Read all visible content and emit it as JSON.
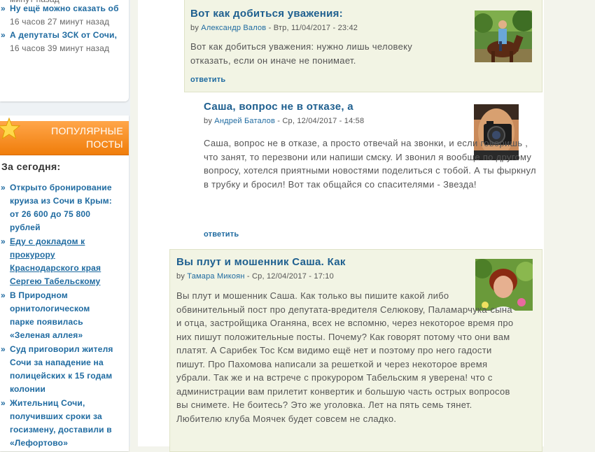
{
  "sidebar": {
    "prev_fragment": "минут назад",
    "recent": [
      {
        "title": "Ну ещё можно сказать об",
        "ago": "16 часов 27 минут назад"
      },
      {
        "title": "А депутаты ЗСК от Сочи,",
        "ago": "16 часов 39 минут назад"
      }
    ],
    "popular_header_line1": "ПОПУЛЯРНЫЕ",
    "popular_header_line2": "ПОСТЫ",
    "today_label": "За сегодня:",
    "popular": [
      {
        "title": "Открыто бронирование круиза из Сочи в Крым: от 26 600 до 75 800 рублей"
      },
      {
        "title": "Еду с докладом к прокурору Краснодарского края Сергею Табельскому"
      },
      {
        "title": "В Природном орнитологическом парке появилась «Зеленая аллея»"
      },
      {
        "title": "Суд приговорил жителя Сочи за нападение на полицейских к 15 годам колонии"
      },
      {
        "title": "Жительниц Сочи, получивших сроки за госизмену, доставили в «Лефортово»"
      }
    ]
  },
  "comments": [
    {
      "title": "Вот как добиться уважения:",
      "by": "by",
      "author": "Александр Валов",
      "date": " - Втр, 11/04/2017 - 23:42",
      "body": "Вот как добиться уважения: нужно лишь человеку отказать, если он иначе не понимает.",
      "reply": "ответить"
    },
    {
      "title": "Саша, вопрос не в отказе, а",
      "by": "by",
      "author": "Андрей Баталов",
      "date": " - Ср, 12/04/2017 - 14:58",
      "body": "Саша, вопрос не в отказе, а просто отвечай на звонки, и если говоришь , что занят, то перезвони или напиши смску. И звонил я вообще по другому вопросу, хотелся приятными новостями поделиться с тобой. А ты фыркнул в трубку и бросил! Вот так общайся со спасителями -  Звезда!",
      "reply": "ответить"
    },
    {
      "title": "Вы плут и мошенник Саша. Как",
      "by": "by",
      "author": "Тамара Микоян",
      "date": " - Ср, 12/04/2017 - 17:10",
      "body": "Вы плут и мошенник Саша. Как только вы пишите какой либо обвинительный пост про депутата-вредителя Селюкову, Паламарчука-сына и отца, застройщика Оганяна, всех не вспомню, через некоторое время про них пишут положительные посты. Почему? Как говорят потому что они вам платят. А Сарибек Тос Ксм видимо ещё нет и поэтому про него гадости пишут. Про Пахомова написали за решеткой и через некоторое время убрали. Так же и на встрече с прокурором Табельским я уверена! что с администрации вам прилетит конвертик и большую часть острых вопросов вы снимете. Не боитесь? Это же уголовка. Лет на пять семь тянет. Любителю клуба Моячек будет совсем не сладко."
    }
  ],
  "colors": {
    "link": "#1e6aa0",
    "popular_header": "#f07d0a",
    "comment_bg": "#f2f4e4"
  }
}
